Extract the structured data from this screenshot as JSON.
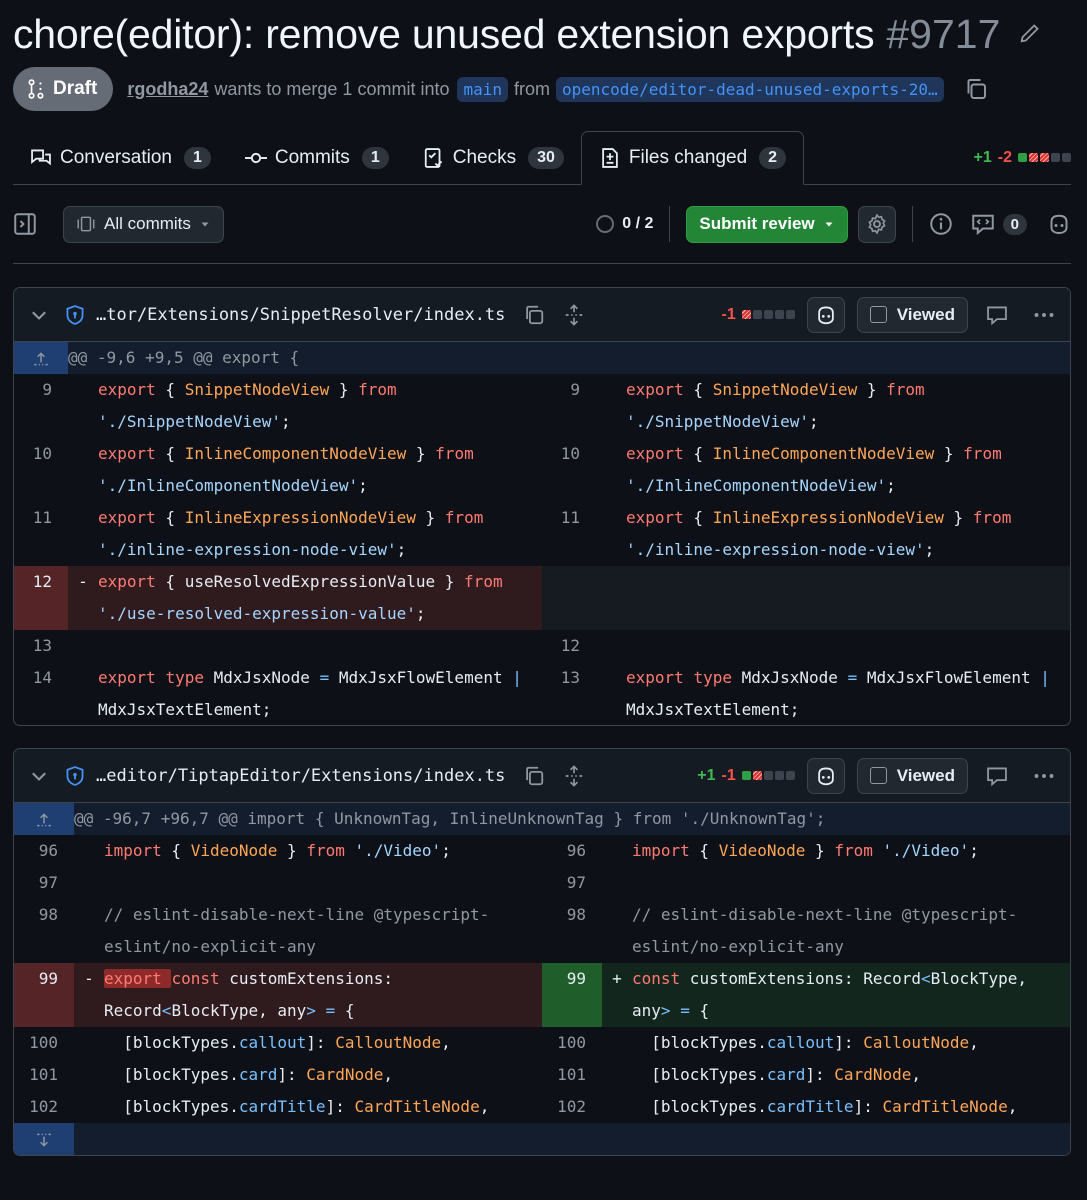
{
  "pr": {
    "title": "chore(editor): remove unused extension exports",
    "number": "#9717",
    "status": "Draft",
    "author": "rgodha24",
    "merge_text": "wants to merge 1 commit into",
    "base_branch": "main",
    "from_text": "from",
    "head_branch": "opencode/editor-dead-unused-exports-20…"
  },
  "tabs": [
    {
      "label": "Conversation",
      "count": "1"
    },
    {
      "label": "Commits",
      "count": "1"
    },
    {
      "label": "Checks",
      "count": "30"
    },
    {
      "label": "Files changed",
      "count": "2"
    }
  ],
  "diffstat": {
    "additions": "+1",
    "deletions": "-2"
  },
  "toolbar": {
    "all_commits": "All commits",
    "viewed_progress": "0 / 2",
    "submit_review": "Submit review",
    "comments_count": "0"
  },
  "files": [
    {
      "path": "…tor/Extensions/SnippetResolver/index.ts",
      "additions": "",
      "deletions": "-1",
      "viewed_label": "Viewed",
      "hunk": "@@ -9,6 +9,5 @@ export {"
    },
    {
      "path": "…editor/TiptapEditor/Extensions/index.ts",
      "additions": "+1",
      "deletions": "-1",
      "viewed_label": "Viewed",
      "hunk": "@@ -96,7 +96,7 @@ import { UnknownTag, InlineUnknownTag } from './UnknownTag';"
    }
  ],
  "colors": {
    "accent_green": "#238636",
    "add_text": "#3fb950",
    "del_text": "#f85149",
    "link_blue": "#4493f8"
  }
}
